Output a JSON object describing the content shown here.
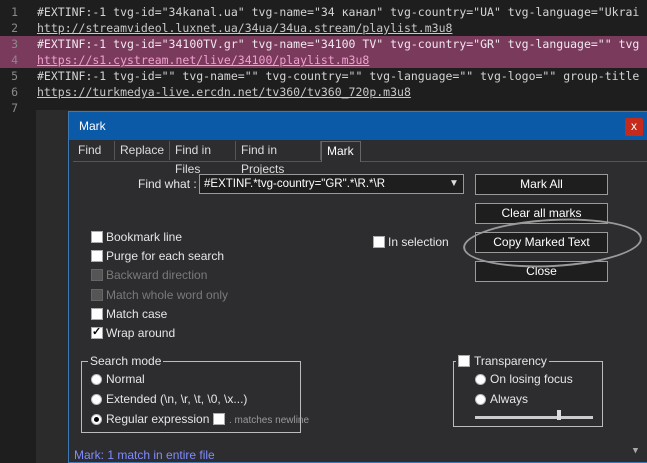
{
  "editor": {
    "lines": [
      {
        "n": "1",
        "text": "#EXTINF:-1 tvg-id=\"34kanal.ua\" tvg-name=\"34 канал\" tvg-country=\"UA\" tvg-language=\"Ukrai",
        "hl": false,
        "url": false
      },
      {
        "n": "2",
        "text": "http://streamvideol.luxnet.ua/34ua/34ua.stream/playlist.m3u8",
        "hl": false,
        "url": true
      },
      {
        "n": "3",
        "text": "#EXTINF:-1 tvg-id=\"34100TV.gr\" tvg-name=\"34100 TV\" tvg-country=\"GR\" tvg-language=\"\" tvg",
        "hl": true,
        "url": false
      },
      {
        "n": "4",
        "text": "https://s1.cystream.net/live/34100/playlist.m3u8",
        "hl": true,
        "url": true
      },
      {
        "n": "5",
        "text": "#EXTINF:-1 tvg-id=\"\" tvg-name=\"\" tvg-country=\"\" tvg-language=\"\" tvg-logo=\"\" group-title",
        "hl": false,
        "url": false
      },
      {
        "n": "6",
        "text": "https://turkmedya-live.ercdn.net/tv360/tv360_720p.m3u8",
        "hl": false,
        "url": true
      },
      {
        "n": "7",
        "text": "",
        "hl": false,
        "url": false
      }
    ]
  },
  "dialog": {
    "title": "Mark",
    "close_label": "x",
    "tabs": [
      "Find",
      "Replace",
      "Find in Files",
      "Find in Projects",
      "Mark"
    ],
    "active_tab": "Mark",
    "find_what_label": "Find what :",
    "find_what_value": "#EXTINF.*tvg-country=\"GR\".*\\R.*\\R",
    "buttons": {
      "mark_all": "Mark All",
      "clear_all_marks": "Clear all marks",
      "copy_marked_text": "Copy Marked Text",
      "close": "Close"
    },
    "options": {
      "bookmark_line": "Bookmark line",
      "purge": "Purge for each search",
      "backward": "Backward direction",
      "whole_word": "Match whole word only",
      "match_case": "Match case",
      "wrap_around": "Wrap around",
      "in_selection": "In selection"
    },
    "search_mode": {
      "title": "Search mode",
      "normal": "Normal",
      "extended": "Extended (\\n, \\r, \\t, \\0, \\x...)",
      "regex": "Regular expression",
      "matches_newline": ". matches newline",
      "selected": "Regular expression"
    },
    "transparency": {
      "title": "Transparency",
      "on_losing_focus": "On losing focus",
      "always": "Always"
    },
    "status": "Mark: 1 match in entire file"
  }
}
